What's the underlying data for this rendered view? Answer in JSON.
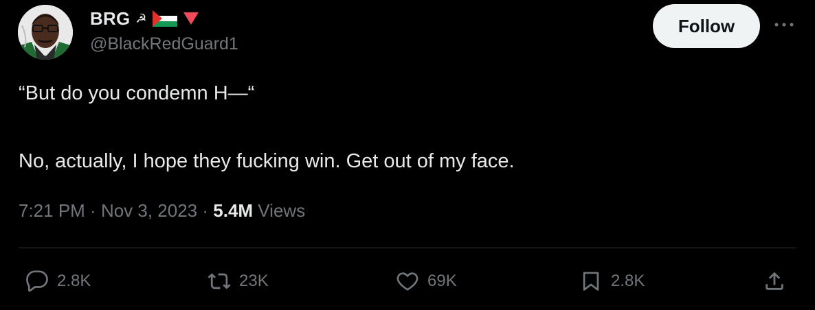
{
  "user": {
    "display_name": "BRG",
    "handle": "@BlackRedGuard1",
    "badges": [
      "hammer-sickle-icon",
      "palestine-flag-icon",
      "red-triangle-icon"
    ]
  },
  "follow_label": "Follow",
  "tweet": {
    "line1": "“But do you condemn H—“",
    "line2": "No, actually, I hope they fucking win. Get out of my face."
  },
  "meta": {
    "time": "7:21 PM",
    "sep1": " · ",
    "date": "Nov 3, 2023",
    "sep2": " · ",
    "views_count": "5.4M",
    "views_label": " Views"
  },
  "actions": {
    "replies": "2.8K",
    "reposts": "23K",
    "likes": "69K",
    "bookmarks": "2.8K"
  },
  "colors": {
    "background": "#000000",
    "text": "#e7e9ea",
    "secondary": "#71767b",
    "follow_bg": "#eff3f4",
    "flag_red": "#e4312b",
    "flag_green": "#149954"
  }
}
